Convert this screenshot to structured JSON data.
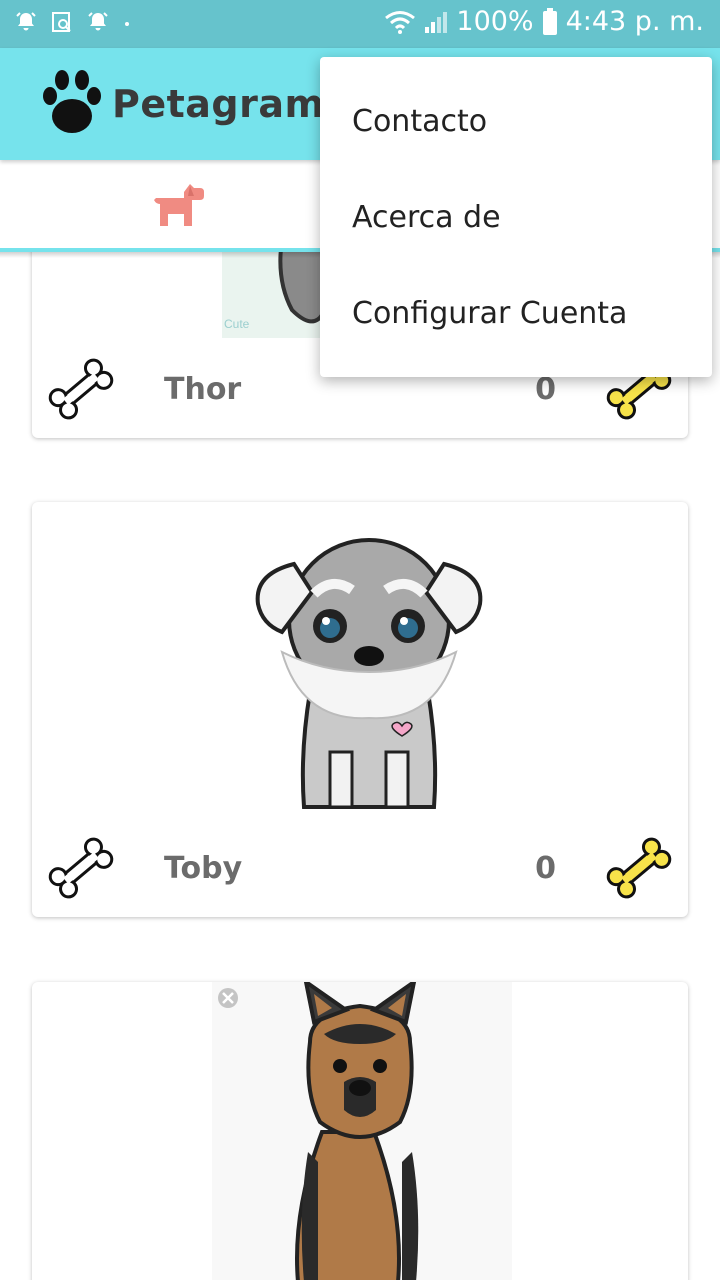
{
  "status_bar": {
    "battery": "100%",
    "time": "4:43 p. m.",
    "icons": [
      "alarm-icon",
      "screenshot-search-icon",
      "alarm-icon",
      "dot-icon",
      "wifi-icon",
      "signal-icon",
      "battery-icon"
    ]
  },
  "app_bar": {
    "title": "Petagram",
    "logo_icon": "paw-icon",
    "color": "#76e3ec"
  },
  "tabs": [
    {
      "icon": "dog-icon",
      "selected": true,
      "color": "#f08b82"
    }
  ],
  "menu": {
    "items": [
      {
        "label": "Contacto"
      },
      {
        "label": "Acerca de"
      },
      {
        "label": "Configurar Cuenta"
      }
    ]
  },
  "pets": [
    {
      "name": "Thor",
      "likes": "0",
      "image": "schnauzer-image"
    },
    {
      "name": "Toby",
      "likes": "0",
      "image": "schnauzer-image"
    },
    {
      "image": "german-shepherd-image"
    }
  ],
  "colors": {
    "status_bar": "#66c3cc",
    "accent": "#76e3ec",
    "bone_yellow": "#f7e34a"
  }
}
